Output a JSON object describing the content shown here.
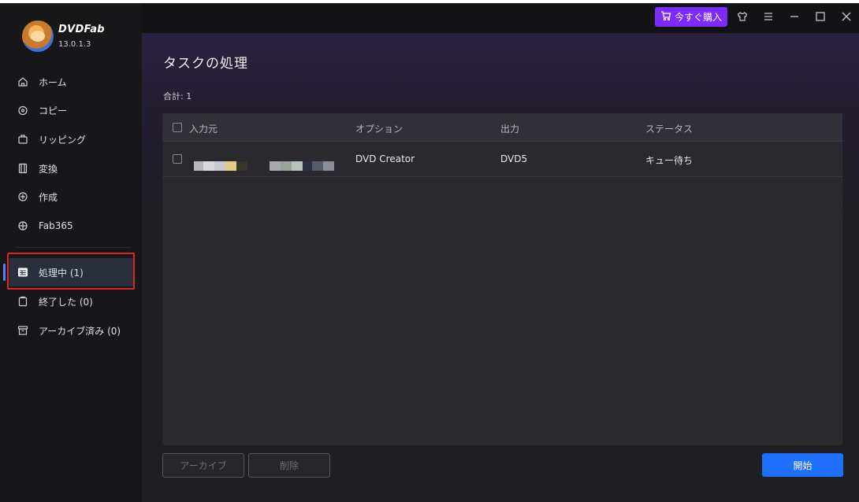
{
  "app": {
    "brand_name": "DVDFab",
    "version": "13.0.1.3",
    "buy_label": "今すぐ購入"
  },
  "sidebar": {
    "items": [
      {
        "label": "ホーム",
        "icon": "home-icon"
      },
      {
        "label": "コピー",
        "icon": "copy-disc-icon"
      },
      {
        "label": "リッピング",
        "icon": "ripping-icon"
      },
      {
        "label": "変換",
        "icon": "film-icon"
      },
      {
        "label": "作成",
        "icon": "create-disc-icon"
      },
      {
        "label": "Fab365",
        "icon": "fab365-icon"
      }
    ],
    "task_items": [
      {
        "label": "処理中 (1)",
        "icon": "processing-list-icon",
        "active": true
      },
      {
        "label": "終了した (0)",
        "icon": "finished-clipboard-icon",
        "active": false
      },
      {
        "label": "アーカイブ済み (0)",
        "icon": "archive-box-icon",
        "active": false
      }
    ]
  },
  "main": {
    "title": "タスクの処理",
    "total": "合計: 1",
    "columns": [
      "入力元",
      "オプション",
      "出力",
      "ステータス"
    ],
    "rows": [
      {
        "option": "DVD Creator",
        "output": "DVD5",
        "status": "キュー待ち"
      }
    ],
    "archive_label": "アーカイブ",
    "delete_label": "削除",
    "start_label": "開始"
  },
  "colors": {
    "accent": "#1f6fff",
    "buy": "#7b2bff",
    "highlight": "#e02323"
  }
}
